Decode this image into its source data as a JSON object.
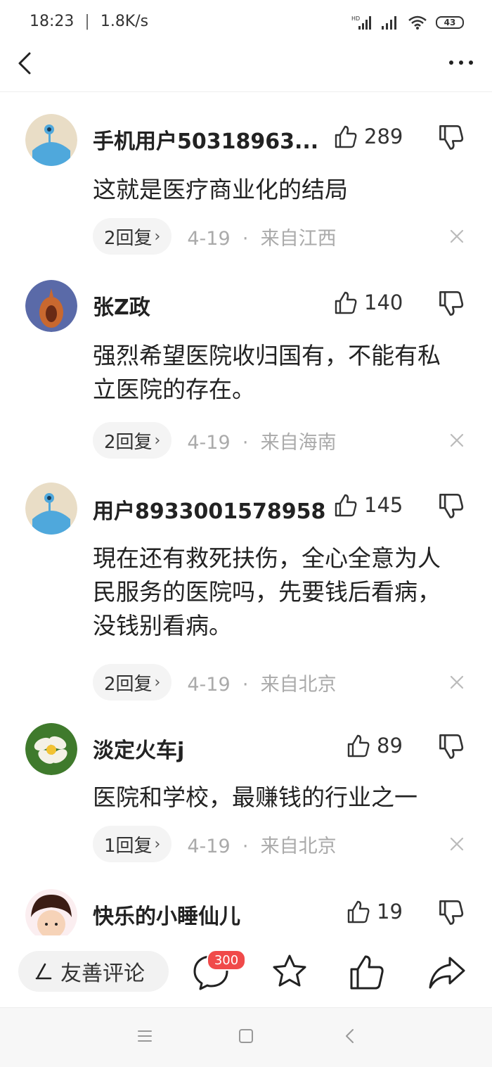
{
  "status_bar": {
    "time": "18:23",
    "net_speed": "1.8K/s",
    "battery": "43",
    "signal_label": "HD"
  },
  "comments": [
    {
      "username": "手机用户50318963...",
      "likes": "289",
      "text": "这就是医疗商业化的结局",
      "replies": "2回复",
      "date": "4-19",
      "location": "来自江西"
    },
    {
      "username": "张Z政",
      "likes": "140",
      "text": "强烈希望医院收归国有，不能有私立医院的存在。",
      "replies": "2回复",
      "date": "4-19",
      "location": "来自海南"
    },
    {
      "username": "用户8933001578958",
      "likes": "145",
      "text": "現在还有救死扶伤，全心全意为人民服务的医院吗，先要钱后看病，没钱别看病。",
      "replies": "2回复",
      "date": "4-19",
      "location": "来自北京"
    },
    {
      "username": "淡定火车j",
      "likes": "89",
      "text": "医院和学校，最赚钱的行业之一",
      "replies": "1回复",
      "date": "4-19",
      "location": "来自北京"
    },
    {
      "username": "快乐的小睡仙儿",
      "likes": "19"
    }
  ],
  "meta_separator": "·",
  "bottom_bar": {
    "comment_placeholder": "友善评论",
    "comment_count": "300"
  },
  "colors": {
    "badge": "#f04a4a",
    "meta_gray": "#aaaaaa",
    "pill_bg": "#f4f4f4"
  },
  "icons": [
    "back-icon",
    "more-icon",
    "thumb-up-icon",
    "thumb-down-icon",
    "close-icon",
    "pen-icon",
    "comment-bubble-icon",
    "star-icon",
    "share-icon",
    "menu-icon",
    "home-icon",
    "system-back-icon"
  ]
}
